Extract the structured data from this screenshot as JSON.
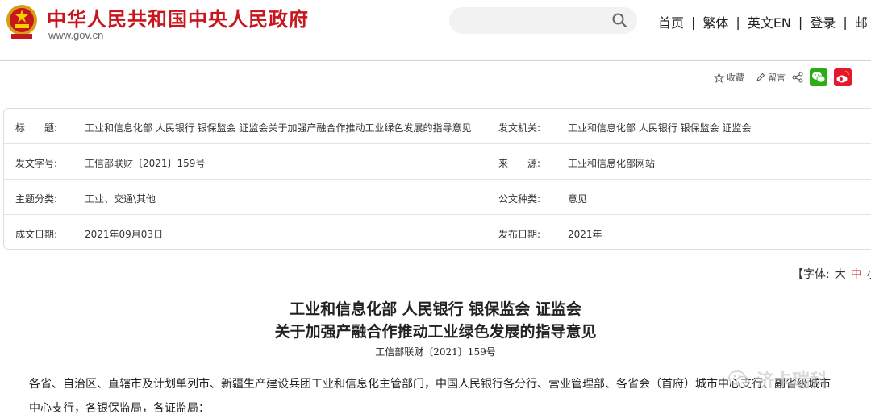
{
  "header": {
    "site_title": "中华人民共和国中央人民政府",
    "site_url": "www.gov.cn",
    "search_placeholder": "",
    "nav": [
      "首页",
      "繁体",
      "英文EN",
      "登录",
      "邮"
    ]
  },
  "share": {
    "favorite": "收藏",
    "comment": "留言"
  },
  "info": {
    "rows": [
      {
        "label1": "标　　题:",
        "value1": "工业和信息化部 人民银行 银保监会 证监会关于加强产融合作推动工业绿色发展的指导意见",
        "label2": "发文机关:",
        "value2": "工业和信息化部 人民银行 银保监会 证监会"
      },
      {
        "label1": "发文字号:",
        "value1": "工信部联财〔2021〕159号",
        "label2": "来　　源:",
        "value2": "工业和信息化部网站"
      },
      {
        "label1": "主题分类:",
        "value1": "工业、交通\\其他",
        "label2": "公文种类:",
        "value2": "意见"
      },
      {
        "label1": "成文日期:",
        "value1": "2021年09月03日",
        "label2": "发布日期:",
        "value2": "2021年"
      }
    ]
  },
  "font_bar": {
    "prefix": "【字体:",
    "large": "大",
    "medium": "中",
    "small": "小"
  },
  "article": {
    "title_line1": "工业和信息化部 人民银行 银保监会 证监会",
    "title_line2": "关于加强产融合作推动工业绿色发展的指导意见",
    "doc_no": "工信部联财〔2021〕159号",
    "para_line1": "各省、自治区、直辖市及计划单列市、新疆生产建设兵团工业和信息化主管部门，中国人民银行各分行、营业管理部、各省会（首府）城市中心支行、副省级城市",
    "para_line2": "中心支行，各银保监局，各证监局："
  },
  "watermark": {
    "text": "济卡瑞科"
  },
  "colors": {
    "brand_red": "#c8161e",
    "wechat_green": "#2bad13",
    "weibo_orange": "#e6162d"
  }
}
